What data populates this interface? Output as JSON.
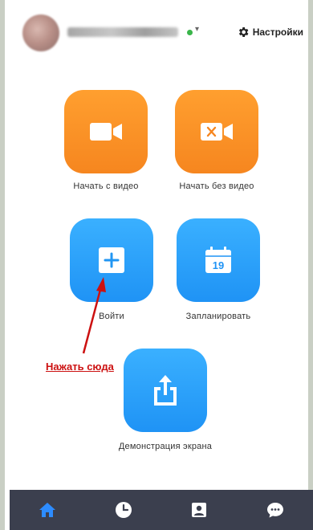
{
  "header": {
    "settings_label": "Настройки"
  },
  "actions": [
    {
      "label": "Начать с видео"
    },
    {
      "label": "Начать без видео"
    },
    {
      "label": "Войти"
    },
    {
      "label": "Запланировать"
    },
    {
      "label": "Демонстрация экрана"
    }
  ],
  "annotation": {
    "text": "Нажать сюда"
  },
  "calendar": {
    "day": "19"
  },
  "colors": {
    "orange": "#f7901f",
    "blue": "#2da3fb",
    "nav_bg": "#3b3f4e",
    "nav_active": "#2d8cff",
    "annotation_red": "#cc1111"
  },
  "nav": [
    "home-icon",
    "clock-icon",
    "contacts-icon",
    "chat-icon"
  ]
}
